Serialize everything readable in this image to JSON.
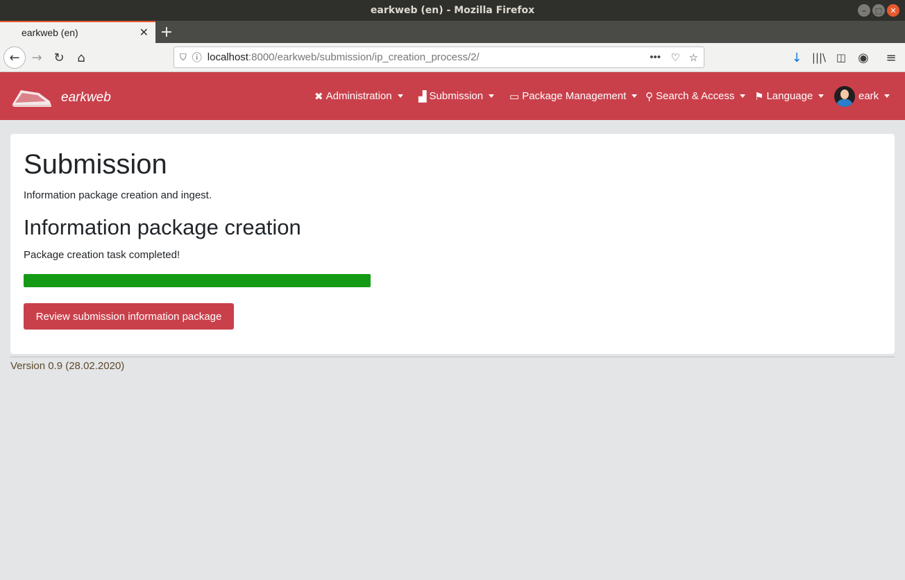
{
  "window": {
    "title": "earkweb (en) - Mozilla Firefox"
  },
  "tabs": [
    {
      "title": "earkweb (en)"
    }
  ],
  "toolbar": {
    "url_host": "localhost",
    "url_path": ":8000/earkweb/submission/ip_creation_process/2/"
  },
  "app": {
    "brand": "earkweb",
    "menu": [
      {
        "label": "Administration",
        "icon": "tools-icon"
      },
      {
        "label": "Submission",
        "icon": "boxes-icon"
      },
      {
        "label": "Package Management",
        "icon": "archive-icon"
      },
      {
        "label": "Search & Access",
        "icon": "search-icon"
      },
      {
        "label": "Language",
        "icon": "flag-icon"
      },
      {
        "label": "eark",
        "icon": "avatar-icon"
      }
    ]
  },
  "page": {
    "title": "Submission",
    "lead": "Information package creation and ingest.",
    "section_title": "Information package creation",
    "status": "Package creation task completed!",
    "progress": 1.0,
    "button": "Review submission information package"
  },
  "footer": {
    "version": "Version 0.9 (28.02.2020)"
  },
  "colors": {
    "brand": "#c9404b",
    "progress": "#159a15"
  }
}
